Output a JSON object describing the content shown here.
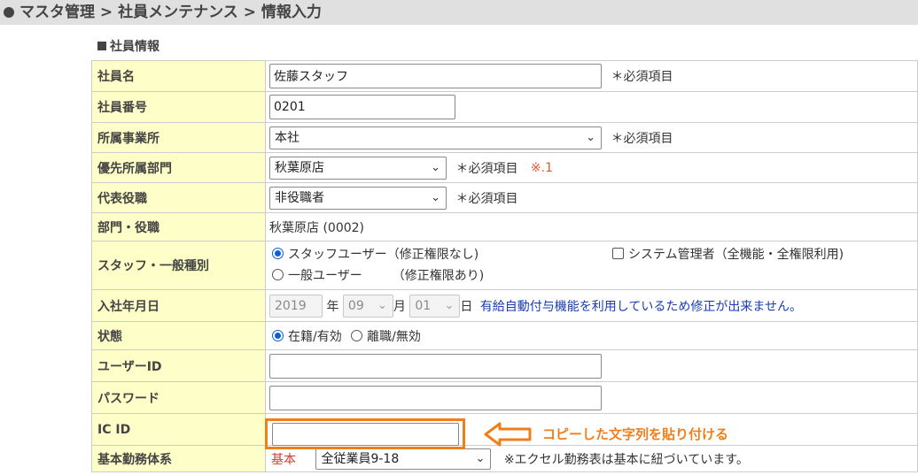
{
  "header": {
    "crumb1": "マスタ管理",
    "sep": ">",
    "crumb2": "社員メンテナンス",
    "crumb3": "情報入力"
  },
  "section_title": "社員情報",
  "required_label": "＊必須項目",
  "fields": {
    "name": {
      "label": "社員名",
      "value": "佐藤スタッフ"
    },
    "number": {
      "label": "社員番号",
      "value": "0201"
    },
    "office": {
      "label": "所属事業所",
      "selected": "本社"
    },
    "dept": {
      "label": "優先所属部門",
      "selected": "秋葉原店",
      "note": "※.1"
    },
    "role": {
      "label": "代表役職",
      "selected": "非役職者"
    },
    "dept_role": {
      "label": "部門・役職",
      "value": "秋葉原店 (0002)"
    },
    "staff_type": {
      "label": "スタッフ・一般種別",
      "opt_staff": "スタッフユーザー（修正権限なし)",
      "opt_general_a": "一般ユーザー",
      "opt_general_b": "（修正権限あり)",
      "opt_admin": "システム管理者（全機能・全権限利用)",
      "selected": "staff",
      "admin_checked": false
    },
    "hire_date": {
      "label": "入社年月日",
      "year": "2019",
      "year_unit": "年",
      "month": "09",
      "month_unit": "月",
      "day": "01",
      "day_unit": "日",
      "notice": "有給自動付与機能を利用しているため修正が出来ません。"
    },
    "status": {
      "label": "状態",
      "opt_active": "在籍/有効",
      "opt_inactive": "離職/無効",
      "selected": "active"
    },
    "user_id": {
      "label": "ユーザーID",
      "value": ""
    },
    "password": {
      "label": "パスワード",
      "value": ""
    },
    "ic_id": {
      "label": "IC ID",
      "value": ""
    },
    "work_system": {
      "label": "基本勤務体系",
      "tag": "基本",
      "selected": "全従業員9-18",
      "note": "※エクセル勤務表は基本に紐づいています。"
    }
  },
  "annotation": {
    "text": "コピーした文字列を貼り付ける",
    "color": "#f07e1a"
  },
  "colors": {
    "label_bg": "#fefec8",
    "header_bg": "#e0e0e0",
    "accent_blue": "#1a3bb5",
    "accent_red": "#d23a2a"
  }
}
